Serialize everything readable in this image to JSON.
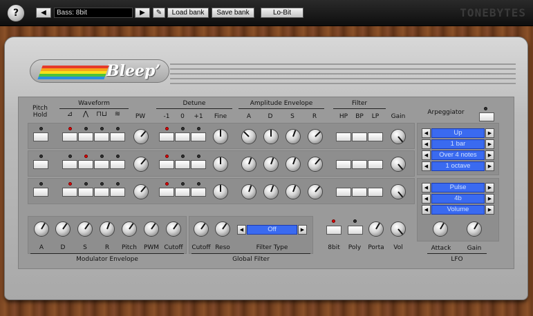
{
  "toolbar": {
    "preset_name": "Bass: 8bit",
    "prev_icon": "left-arrow-icon",
    "next_icon": "right-arrow-icon",
    "edit_icon": "pencil-icon",
    "load_label": "Load bank",
    "save_label": "Save bank",
    "mode_label": "Lo-Bit",
    "brand": "TONEBYTES"
  },
  "plugin": {
    "logo_text": "Bleep’"
  },
  "headers": {
    "pitch_hold": "Pitch\nHold",
    "waveform": "Waveform",
    "pw": "PW",
    "detune": "Detune",
    "detune_minus": "-1",
    "detune_zero": "0",
    "detune_plus": "+1",
    "fine": "Fine",
    "amp_env": "Amplitude Envelope",
    "amp_a": "A",
    "amp_d": "D",
    "amp_s": "S",
    "amp_r": "R",
    "filter": "Filter",
    "hp": "HP",
    "bp": "BP",
    "lp": "LP",
    "gain": "Gain",
    "arpeggiator": "Arpeggiator"
  },
  "waveform_icons": [
    "saw-wave-icon",
    "triangle-wave-icon",
    "square-wave-icon",
    "noise-wave-icon"
  ],
  "osc_rows": [
    {
      "wave_on": 0,
      "detune_on": 0
    },
    {
      "wave_on": 1,
      "detune_on": 0
    },
    {
      "wave_on": 0,
      "detune_on": 0
    }
  ],
  "arp": {
    "items": [
      "Up",
      "1 bar",
      "Over 4 notes",
      "1 octave"
    ]
  },
  "lfo": {
    "items": [
      "Pulse",
      "4b",
      "Volume"
    ],
    "attack": "Attack",
    "gain": "Gain",
    "title": "LFO"
  },
  "modulator": {
    "labels": [
      "A",
      "D",
      "S",
      "R",
      "Pitch",
      "PWM",
      "Cutoff"
    ],
    "title": "Modulator Envelope"
  },
  "global_filter": {
    "cutoff": "Cutoff",
    "reso": "Reso",
    "filter_type": "Off",
    "filter_type_label": "Filter Type",
    "title": "Global Filter"
  },
  "misc": {
    "bit8": "8bit",
    "poly": "Poly",
    "porta": "Porta",
    "vol": "Vol"
  }
}
